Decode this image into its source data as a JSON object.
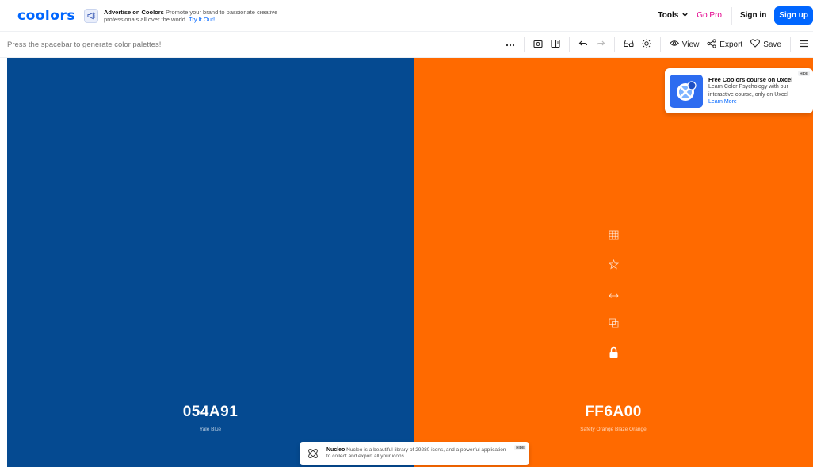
{
  "header": {
    "logo_text": "coolors",
    "ad": {
      "title": "Advertise on Coolors",
      "text": "Promote your brand to passionate creative professionals all over the world.",
      "link": "Try It Out!"
    },
    "tools_label": "Tools",
    "gopro_label": "Go Pro",
    "signin_label": "Sign in",
    "signup_label": "Sign up"
  },
  "toolbar": {
    "hint": "Press the spacebar to generate color palettes!",
    "view_label": "View",
    "export_label": "Export",
    "save_label": "Save"
  },
  "palette": [
    {
      "hex": "054A91",
      "name": "Yale Blue",
      "color": "#054A91"
    },
    {
      "hex": "FF6A00",
      "name": "Safety Orange Blaze Orange",
      "color": "#FF6A00"
    }
  ],
  "uxcel_ad": {
    "title": "Free Coolors course on Uxcel",
    "text": "Learn Color Psychology with our interactive course, only on Uxcel",
    "link": "Learn More",
    "hide_label": "HIDE"
  },
  "nucleo_ad": {
    "title": "Nucleo",
    "text": "Nucleo is a beautiful library of 29280 icons, and a powerful application to collect and export all your icons.",
    "hide_label": "HIDE"
  },
  "colors": {
    "accent": "#0066ff",
    "pro": "#e3008c"
  }
}
